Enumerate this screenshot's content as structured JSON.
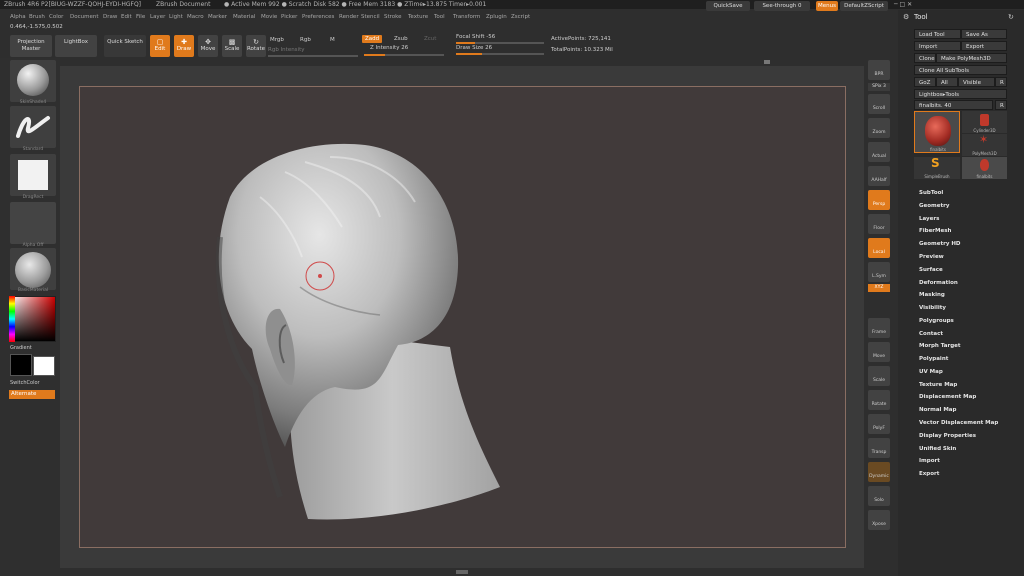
{
  "title_bar": {
    "app": "ZBrush 4R6 P2[BIUG-WZZF-QOHJ-EYDI-HGFQ]",
    "document": "ZBrush Document",
    "memory": "● Active Mem 992 ● Scratch Disk 582 ● Free Mem 3183 ● ZTime▸13.875 Timer▸0.001",
    "quicksave": "QuickSave",
    "see_through": "See-through  0",
    "menus_label": "Menus",
    "script": "DefaultZScript"
  },
  "menu": [
    "Alpha",
    "Brush",
    "Color",
    "Document",
    "Draw",
    "Edit",
    "File",
    "Layer",
    "Light",
    "Macro",
    "Marker",
    "Material",
    "Movie",
    "Picker",
    "Preferences",
    "Render",
    "Stencil",
    "Stroke",
    "Texture",
    "Tool",
    "Transform",
    "Zplugin",
    "Zscript"
  ],
  "coords": "0.464,-1.575,0.502",
  "shelf": {
    "projection_master": "Projection Master",
    "lightbox": "LightBox",
    "quick_sketch": "Quick Sketch",
    "edit": "Edit",
    "draw": "Draw",
    "move": "Move",
    "scale": "Scale",
    "rotate": "Rotate",
    "mrgb": "Mrgb",
    "rgb": "Rgb",
    "m": "M",
    "rgb_intensity": "Rgb Intensity",
    "zadd": "Zadd",
    "zsub": "Zsub",
    "zcut": "Zcut",
    "z_intensity": "Z Intensity 26",
    "focal_shift": "Focal Shift -56",
    "draw_size": "Draw Size 26",
    "active_points": "ActivePoints: 725,141",
    "total_points": "TotalPoints: 10.323 Mil"
  },
  "left_tray": {
    "material": "SkinShade4",
    "brush": "Standard",
    "stroke": "DragRect",
    "alpha": "Alpha Off",
    "texture": "BasicMaterial",
    "gradient": "Gradient",
    "switch_color": "SwitchColor",
    "alternate": "Alternate"
  },
  "right_tray": {
    "bpr": "BPR",
    "spix": "SPix 3",
    "scroll": "Scroll",
    "zoom": "Zoom",
    "actual": "Actual",
    "aahalf": "AAHalf",
    "persp": "Persp",
    "floor": "Floor",
    "local": "Local",
    "lsym": "L.Sym",
    "xyz": "XYZ",
    "frame": "Frame",
    "move": "Move",
    "scale": "Scale",
    "rotate": "Rotate",
    "polyf": "PolyF",
    "transp": "Transp",
    "dynamic": "Dynamic",
    "solo": "Solo",
    "xpose": "Xpose"
  },
  "tool_palette": {
    "title": "Tool",
    "load_tool": "Load Tool",
    "save_as": "Save As",
    "import": "Import",
    "export": "Export",
    "clone": "Clone",
    "make_polymesh": "Make PolyMesh3D",
    "clone_all": "Clone All SubTools",
    "goz": "GoZ",
    "all": "All",
    "visible": "Visible",
    "r": "R",
    "lightbox_tools": "Lightbox▸Tools",
    "current_tool": "finalbits. 40",
    "thumbs": [
      "finalbits",
      "Cylinder3D",
      "PolyMesh3D",
      "SimpleBrush",
      "finalbits"
    ],
    "items": [
      "SubTool",
      "Geometry",
      "Layers",
      "FiberMesh",
      "Geometry HD",
      "Preview",
      "Surface",
      "Deformation",
      "Masking",
      "Visibility",
      "Polygroups",
      "Contact",
      "Morph Target",
      "Polypaint",
      "UV Map",
      "Texture Map",
      "Displacement Map",
      "Normal Map",
      "Vector Displacement Map",
      "Display Properties",
      "Unified Skin",
      "Import",
      "Export"
    ]
  }
}
